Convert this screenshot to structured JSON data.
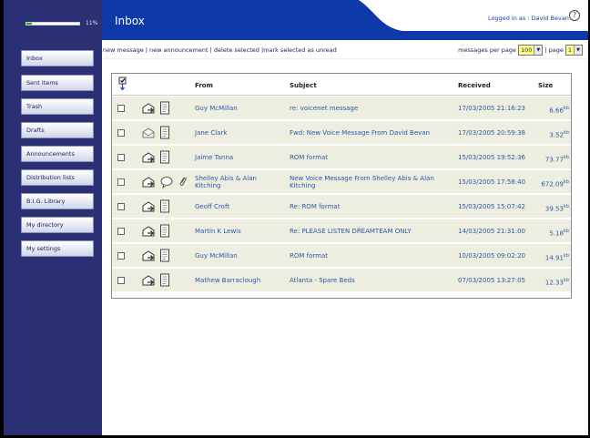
{
  "sidebar": {
    "quota_text": "11%",
    "quota_fraction": 0.11,
    "items": [
      {
        "label": "Inbox"
      },
      {
        "label": "Sent items"
      },
      {
        "label": "Trash"
      },
      {
        "label": "Drafts"
      },
      {
        "label": "Announcements"
      },
      {
        "label": "Distribution lists"
      },
      {
        "label": "B.I.G. Library"
      },
      {
        "label": "My directory"
      },
      {
        "label": "My settings"
      }
    ]
  },
  "header": {
    "title": "Inbox",
    "logged_in": "Logged in as : David Bevan",
    "help_glyph": "?",
    "accent_color": "#0d3aa8"
  },
  "toolbar": {
    "new_message": "new message",
    "new_announcement": "new announcement",
    "delete_selected": "delete selected",
    "mark_unread": "mark selected as unread",
    "sep1": " | ",
    "sep2": " | ",
    "sep3": " |",
    "per_page_label": "messages per page",
    "per_page_value": "100",
    "page_sep": "| page",
    "page_value": "1"
  },
  "table": {
    "columns": {
      "from": "From",
      "subject": "Subject",
      "received": "Received",
      "size": "Size"
    },
    "size_unit": "kb",
    "rows": [
      {
        "from": "Guy McMillan",
        "subject": "re: voicenet message",
        "received": "17/03/2005 21:16:23",
        "size": "6.66",
        "icons": [
          "forward-icon",
          "document-icon"
        ]
      },
      {
        "from": "Jane Clark",
        "subject": "Fwd: New Voice Message From David Bevan",
        "received": "17/03/2005 20:59:38",
        "size": "3.52",
        "icons": [
          "envelope-icon",
          "document-icon"
        ]
      },
      {
        "from": "Jaime Tanna",
        "subject": "ROM format",
        "received": "15/03/2005 19:52:36",
        "size": "73.77",
        "icons": [
          "forward-icon",
          "document-icon"
        ]
      },
      {
        "from": "Shelley Abis & Alan Kitching",
        "subject": "New Voice Message From Shelley Abis & Alan Kitching",
        "received": "15/03/2005 17:58:40",
        "size": "672.09",
        "icons": [
          "forward-icon",
          "speech-bubble-icon",
          "paperclip-icon"
        ]
      },
      {
        "from": "Geoff Croft",
        "subject": "Re: ROM format",
        "received": "15/03/2005 15:07:42",
        "size": "39.53",
        "icons": [
          "forward-icon",
          "document-icon"
        ]
      },
      {
        "from": "Martin K Lewis",
        "subject": "Re: PLEASE LISTEN DREAMTEAM ONLY",
        "received": "14/03/2005 21:31:00",
        "size": "5.18",
        "icons": [
          "forward-icon",
          "document-icon"
        ]
      },
      {
        "from": "Guy McMillan",
        "subject": "ROM format",
        "received": "10/03/2005 09:02:20",
        "size": "14.91",
        "icons": [
          "forward-icon",
          "document-icon"
        ]
      },
      {
        "from": "Mathew Barraclough",
        "subject": "Atlanta - Spare Beds",
        "received": "07/03/2005 13:27:05",
        "size": "12.33",
        "icons": [
          "forward-icon",
          "document-icon"
        ]
      }
    ]
  }
}
